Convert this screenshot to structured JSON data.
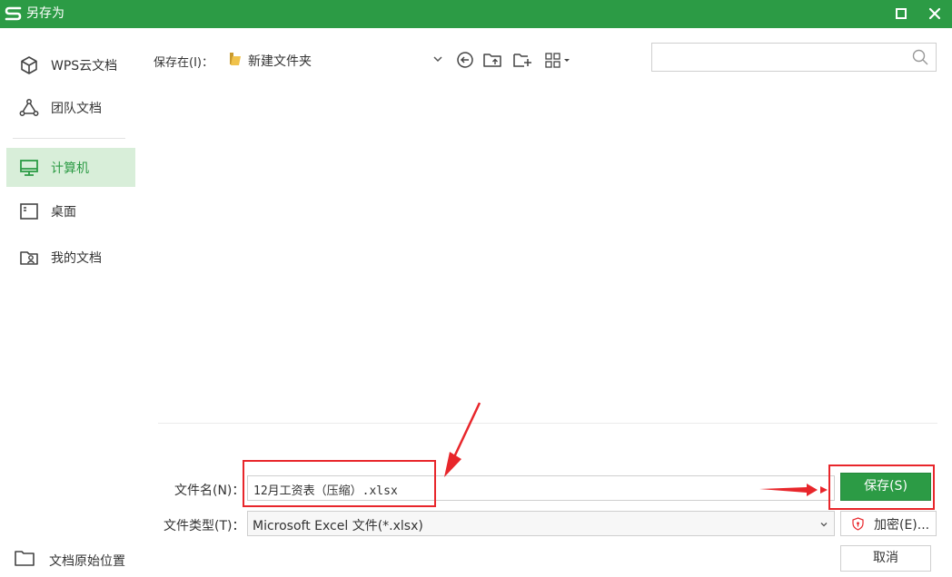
{
  "window": {
    "title": "另存为",
    "accent_color": "#2c9b45",
    "logo_icon": "wps-s-logo-icon",
    "maximize_icon": "maximize-icon",
    "close_icon": "close-icon"
  },
  "sidebar": {
    "items": [
      {
        "label": "WPS云文档",
        "icon": "cube-icon",
        "active": false
      },
      {
        "label": "团队文档",
        "icon": "team-triangle-icon",
        "active": false
      },
      {
        "label": "计算机",
        "icon": "monitor-icon",
        "active": true
      },
      {
        "label": "桌面",
        "icon": "desktop-icon",
        "active": false
      },
      {
        "label": "我的文档",
        "icon": "my-documents-icon",
        "active": false
      }
    ],
    "bottom": {
      "label": "文档原始位置",
      "icon": "folder-outline-icon"
    }
  },
  "toolbar": {
    "save_in_label": "保存在(I)：",
    "location": "新建文件夹",
    "location_icon": "folder-icon",
    "buttons": [
      "chevron-down-icon",
      "back-circle-icon",
      "up-folder-icon",
      "new-folder-icon",
      "view-grid-icon"
    ]
  },
  "search": {
    "placeholder": "",
    "value": "",
    "icon": "search-icon"
  },
  "form": {
    "filename_label": "文件名(N)：",
    "filename_value": "12月工资表（压缩）.xlsx",
    "filetype_label": "文件类型(T)：",
    "filetype_value": "Microsoft Excel 文件(*.xlsx)"
  },
  "buttons": {
    "save": "保存(S)",
    "encrypt": "加密(E)...",
    "cancel": "取消"
  },
  "annotation_color": "#e8262b"
}
